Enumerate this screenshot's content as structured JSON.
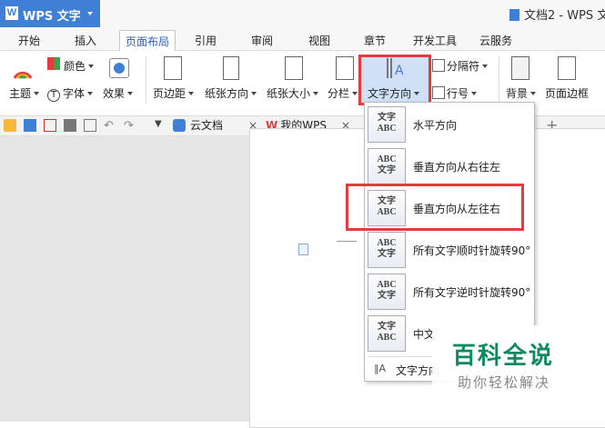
{
  "app": {
    "name": "WPS 文字",
    "logo_letter": "W",
    "doc_title": "文档2 - WPS 文..."
  },
  "tabs": [
    {
      "label": "开始"
    },
    {
      "label": "插入"
    },
    {
      "label": "页面布局"
    },
    {
      "label": "引用"
    },
    {
      "label": "审阅"
    },
    {
      "label": "视图"
    },
    {
      "label": "章节"
    },
    {
      "label": "开发工具"
    },
    {
      "label": "云服务"
    }
  ],
  "ribbon": {
    "theme": "主题",
    "color": "颜色",
    "font": "字体",
    "effect": "效果",
    "margin": "页边距",
    "orientation": "纸张方向",
    "size": "纸张大小",
    "columns": "分栏",
    "text_direction": "文字方向",
    "break": "分隔符",
    "line_number": "行号",
    "background": "背景",
    "page_border": "页面边框"
  },
  "doc_tabs": {
    "cloud": "云文档",
    "mywps": "我的WPS"
  },
  "menu": {
    "items": [
      {
        "label": "水平方向",
        "icon_text": "文字\nABC"
      },
      {
        "label": "垂直方向从右往左",
        "icon_text": "ABC\n文字"
      },
      {
        "label": "垂直方向从左往右",
        "icon_text": "文字\nABC"
      },
      {
        "label": "所有文字顺时针旋转90°",
        "icon_text": "ABC\n文字"
      },
      {
        "label": "所有文字逆时针旋转90°",
        "icon_text": "ABC\n文字"
      },
      {
        "label": "中文",
        "icon_text": "文字\nABC"
      }
    ],
    "footer": "文字方向"
  },
  "watermark": {
    "title": "百科全说",
    "subtitle": "助你轻松解决"
  },
  "colors": {
    "accent": "#3f7fd6",
    "highlight": "#e23c3c",
    "watermark": "#0f8a5f"
  }
}
